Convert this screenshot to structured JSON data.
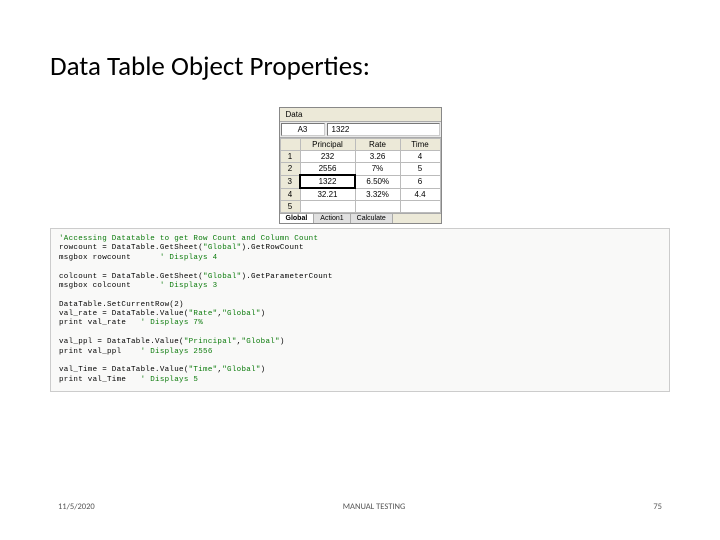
{
  "title": "Data Table Object Properties:",
  "datatable": {
    "panel_label": "Data",
    "cell_ref": "A3",
    "cell_value": "1322",
    "columns": [
      "Principal",
      "Rate",
      "Time"
    ],
    "rows": [
      {
        "n": "1",
        "principal": "232",
        "rate": "3.26",
        "time": "4"
      },
      {
        "n": "2",
        "principal": "2556",
        "rate": "7%",
        "time": "5"
      },
      {
        "n": "3",
        "principal": "1322",
        "rate": "6.50%",
        "time": "6"
      },
      {
        "n": "4",
        "principal": "32.21",
        "rate": "3.32%",
        "time": "4.4"
      },
      {
        "n": "5",
        "principal": "",
        "rate": "",
        "time": ""
      }
    ],
    "tabs": [
      "Global",
      "Action1",
      "Calculate"
    ]
  },
  "code": {
    "l01": "'Accessing Datatable to get Row Count and Column Count",
    "l02a": "rowcount = DataTable.GetSheet(",
    "l02b": "\"Global\"",
    "l02c": ").GetRowCount",
    "l03a": "msgbox rowcount      ",
    "l03b": "' Displays 4",
    "l05a": "colcount = DataTable.GetSheet(",
    "l05b": "\"Global\"",
    "l05c": ").GetParameterCount",
    "l06a": "msgbox colcount      ",
    "l06b": "' Displays 3",
    "l08": "DataTable.SetCurrentRow(2)",
    "l09a": "val_rate = DataTable.Value(",
    "l09b": "\"Rate\"",
    "l09c": ",",
    "l09d": "\"Global\"",
    "l09e": ")",
    "l10a": "print val_rate   ",
    "l10b": "' Displays 7%",
    "l12a": "val_ppl = DataTable.Value(",
    "l12b": "\"Principal\"",
    "l12c": ",",
    "l12d": "\"Global\"",
    "l12e": ")",
    "l13a": "print val_ppl    ",
    "l13b": "' Displays 2556",
    "l15a": "val_Time = DataTable.Value(",
    "l15b": "\"Time\"",
    "l15c": ",",
    "l15d": "\"Global\"",
    "l15e": ")",
    "l16a": "print val_Time   ",
    "l16b": "' Displays 5"
  },
  "footer": {
    "date": "11/5/2020",
    "center": "MANUAL TESTING",
    "page": "75"
  }
}
